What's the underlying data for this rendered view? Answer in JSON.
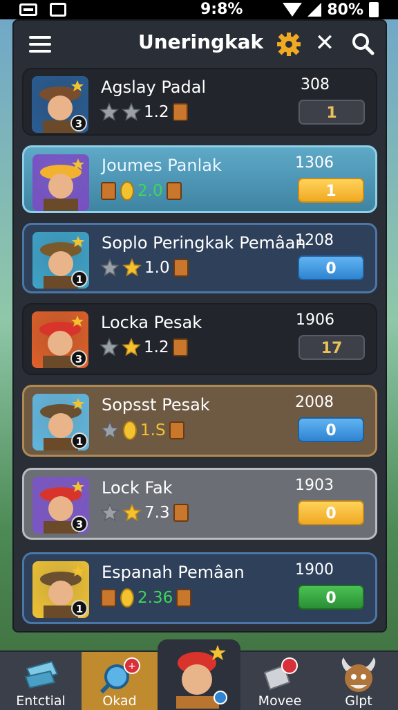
{
  "status": {
    "time": "9:8%",
    "battery": "80%"
  },
  "header": {
    "title": "Uneringkak"
  },
  "players": [
    {
      "name": "Agslay Padal",
      "stars": 2,
      "rating": "1.2",
      "score": "308",
      "value": "1",
      "rank": "3",
      "style": "dark",
      "btn": "gray"
    },
    {
      "name": "Joumes Panlak",
      "stars": 0,
      "rating": "2.0",
      "score": "1306",
      "value": "1",
      "rank": "",
      "style": "teal",
      "btn": "gold"
    },
    {
      "name": "Soplo Peringkak Pemâan",
      "stars": 1,
      "rating": "1.0",
      "score": "1208",
      "value": "0",
      "rank": "1",
      "style": "navy",
      "btn": "blue"
    },
    {
      "name": "Locka Pesak",
      "stars": 1,
      "rating": "1.2",
      "score": "1906",
      "value": "17",
      "rank": "3",
      "style": "dark",
      "btn": "gray"
    },
    {
      "name": "Sopsst Pesak",
      "stars": 1,
      "rating": "1.S",
      "score": "2008",
      "value": "0",
      "rank": "1",
      "style": "brown",
      "btn": "blue"
    },
    {
      "name": "Lock Fak",
      "stars": 1,
      "rating": "7.3",
      "score": "1903",
      "value": "0",
      "rank": "3",
      "style": "gray",
      "btn": "gold"
    },
    {
      "name": "Espanah Pemâan",
      "stars": 0,
      "rating": "2.36",
      "score": "1900",
      "value": "0",
      "rank": "1",
      "style": "navy",
      "btn": "green"
    }
  ],
  "nav": [
    {
      "label": "Entctial"
    },
    {
      "label": "Okad"
    },
    {
      "label": ""
    },
    {
      "label": "Movee"
    },
    {
      "label": "Glpt"
    }
  ],
  "colors": {
    "gold": "#f0a923",
    "blue": "#2f84d2",
    "green": "#2a8f35",
    "teal": "#4b90ad",
    "panel": "#2a2e37"
  }
}
